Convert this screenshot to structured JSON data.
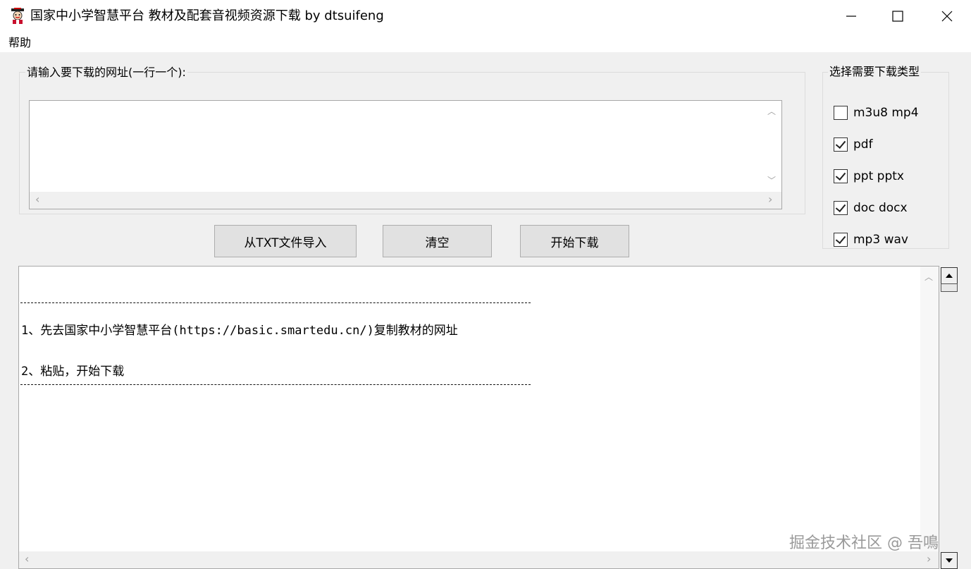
{
  "window": {
    "title": "国家中小学智慧平台 教材及配套音视频资源下载 by dtsuifeng",
    "icon": "app-icon",
    "controls": [
      "minimize-icon",
      "maximize-icon",
      "close-icon"
    ]
  },
  "menu": {
    "items": [
      {
        "label": "帮助"
      }
    ]
  },
  "url_group": {
    "label": "请输入要下载的网址(一行一个):",
    "input_value": ""
  },
  "buttons": {
    "import_label": "从TXT文件导入",
    "clear_label": "清空",
    "start_label": "开始下载"
  },
  "types_group": {
    "label": "选择需要下载类型",
    "options": [
      {
        "label": "m3u8 mp4",
        "checked": false
      },
      {
        "label": "pdf",
        "checked": true
      },
      {
        "label": "ppt pptx",
        "checked": true
      },
      {
        "label": "doc docx",
        "checked": true
      },
      {
        "label": "mp3 wav",
        "checked": true
      }
    ]
  },
  "log": {
    "line1": "1、先去国家中小学智慧平台(https://basic.smartedu.cn/)复制教材的网址",
    "line2": "2、粘贴，开始下载"
  },
  "watermark": "掘金技术社区 @ 吾鳴"
}
